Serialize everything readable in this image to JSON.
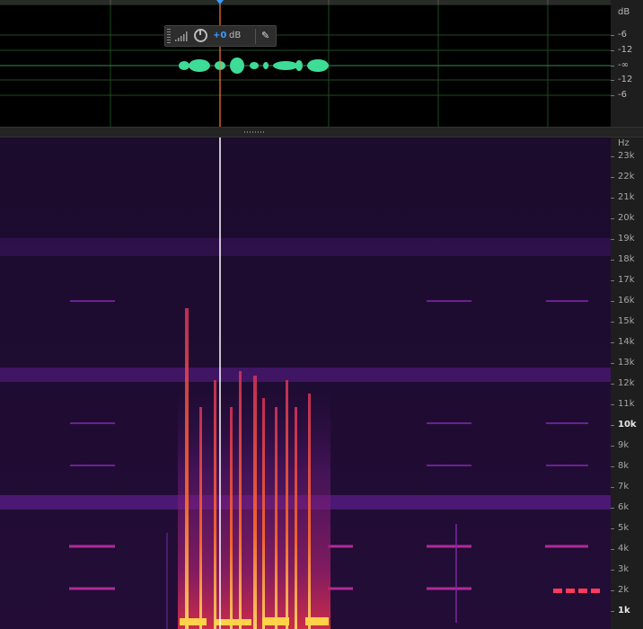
{
  "waveform": {
    "db_unit": "dB",
    "db_labels": [
      "-6",
      "-12",
      "-∞",
      "-12",
      "-6"
    ]
  },
  "hud": {
    "gain_value": "+0",
    "gain_unit": "dB",
    "icons": [
      "grip-icon",
      "level-meter-icon",
      "volume-knob-icon",
      "pin-icon"
    ]
  },
  "spectrogram": {
    "hz_unit": "Hz",
    "hz_labels": [
      "23k",
      "22k",
      "21k",
      "20k",
      "19k",
      "18k",
      "17k",
      "16k",
      "15k",
      "14k",
      "13k",
      "12k",
      "11k",
      "10k",
      "9k",
      "8k",
      "7k",
      "6k",
      "5k",
      "4k",
      "3k",
      "2k",
      "1k"
    ],
    "highlighted_label": "10k"
  },
  "colors": {
    "waveform": "#3ddc97",
    "playhead": "#ff7a33",
    "spectrogram_bg": "#1a0a2b",
    "hud_value": "#3a9cff"
  }
}
